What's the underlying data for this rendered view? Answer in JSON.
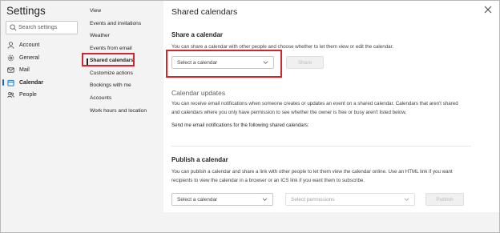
{
  "settings": {
    "title": "Settings",
    "search_placeholder": "Search settings"
  },
  "nav": {
    "items": [
      {
        "label": "Account",
        "icon": "person-icon"
      },
      {
        "label": "General",
        "icon": "gear-icon"
      },
      {
        "label": "Mail",
        "icon": "mail-icon"
      },
      {
        "label": "Calendar",
        "icon": "calendar-icon",
        "active": true
      },
      {
        "label": "People",
        "icon": "people-icon"
      }
    ]
  },
  "subnav": {
    "items": [
      {
        "label": "View"
      },
      {
        "label": "Events and invitations"
      },
      {
        "label": "Weather"
      },
      {
        "label": "Events from email"
      },
      {
        "label": "Shared calendars",
        "active": true
      },
      {
        "label": "Customize actions"
      },
      {
        "label": "Bookings with me"
      },
      {
        "label": "Accounts"
      },
      {
        "label": "Work hours and location"
      }
    ]
  },
  "page": {
    "title": "Shared calendars",
    "share": {
      "heading": "Share a calendar",
      "description": "You can share a calendar with other people and choose whether to let them view or edit the calendar.",
      "select_placeholder": "Select a calendar",
      "button": "Share"
    },
    "updates": {
      "heading": "Calendar updates",
      "description_line1": "You can receive email notifications when someone creates or updates an event on a shared calendar. Calendars that aren't shared",
      "description_line2": "and calendars where you only have permission to see whether the owner is free or busy aren't listed below.",
      "note": "Send me email notifications for the following shared calendars:"
    },
    "publish": {
      "heading": "Publish a calendar",
      "description_line1": "You can publish a calendar and share a link with other people to let them view the calendar online. Use an HTML link if you want",
      "description_line2": "recipients to view the calendar in a browser or an ICS link if you want them to subscribe.",
      "select_calendar": "Select a calendar",
      "select_permissions": "Select permissions",
      "button": "Publish"
    }
  },
  "colors": {
    "accent": "#0f6cbd",
    "highlight": "#d2252d",
    "pane_bg": "#f3f3f3"
  }
}
